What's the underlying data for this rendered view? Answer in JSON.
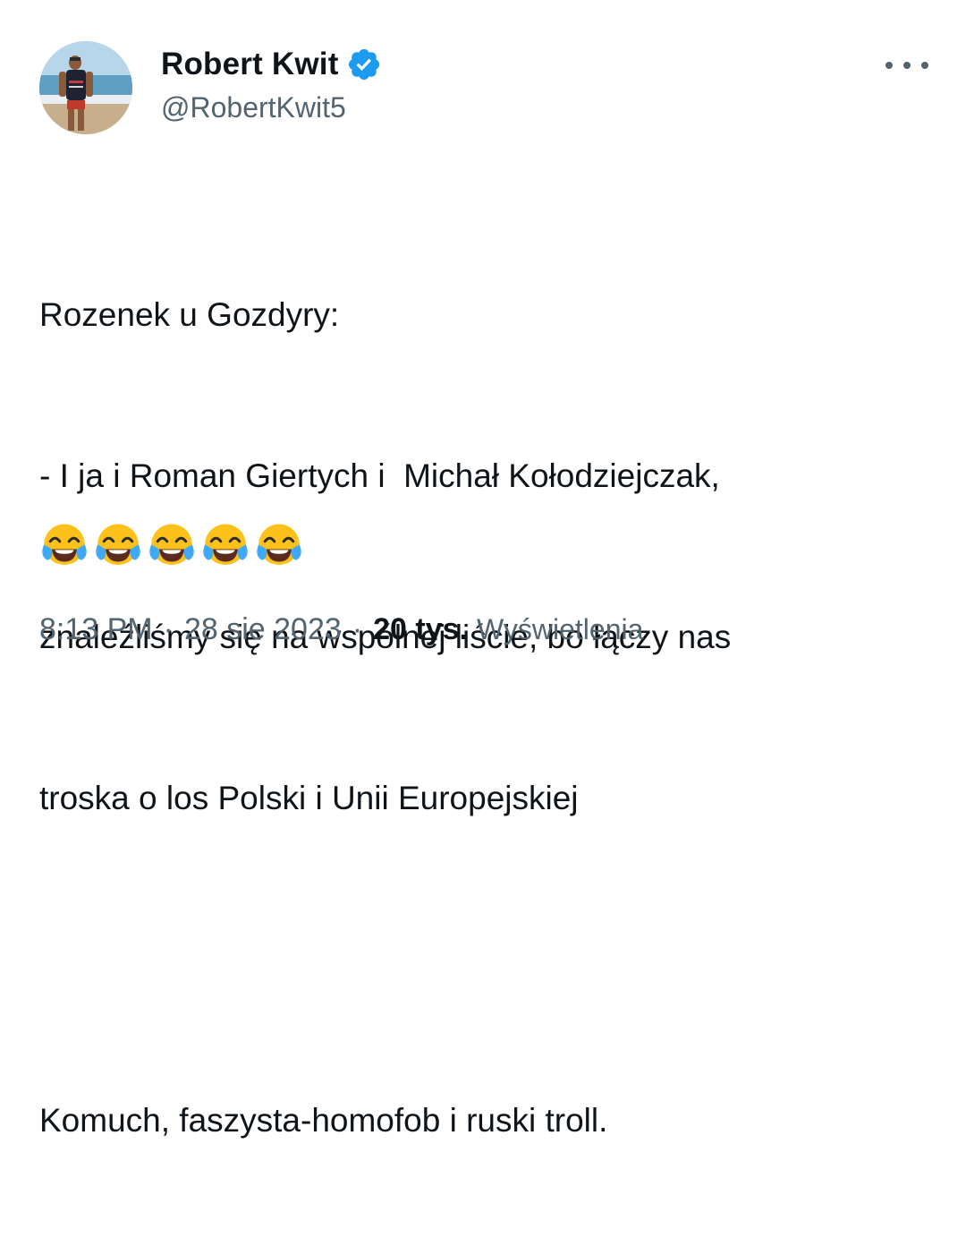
{
  "author": {
    "display_name": "Robert Kwit",
    "handle": "@RobertKwit5",
    "verified": true
  },
  "tweet": {
    "lines": [
      "Rozenek u Gozdyry:",
      "- I ja i Roman Giertych i  Michał Kołodziejczak,",
      "znaleźliśmy się na wspólnej liście, bo łączy nas",
      "troska o los Polski i Unii Europejskiej",
      "",
      "Komuch, faszysta-homofob i ruski troll."
    ],
    "emoji": [
      "face-with-tears-of-joy",
      "face-with-tears-of-joy",
      "face-with-tears-of-joy",
      "face-with-tears-of-joy",
      "face-with-tears-of-joy"
    ]
  },
  "meta": {
    "time": "8:13 PM",
    "separator": "·",
    "date": "28 sie 2023",
    "views_count": "20 tys.",
    "views_label": "Wyświetlenia"
  },
  "colors": {
    "verified_blue": "#1d9bf0",
    "secondary_text": "#536471",
    "primary_text": "#0f1419"
  }
}
